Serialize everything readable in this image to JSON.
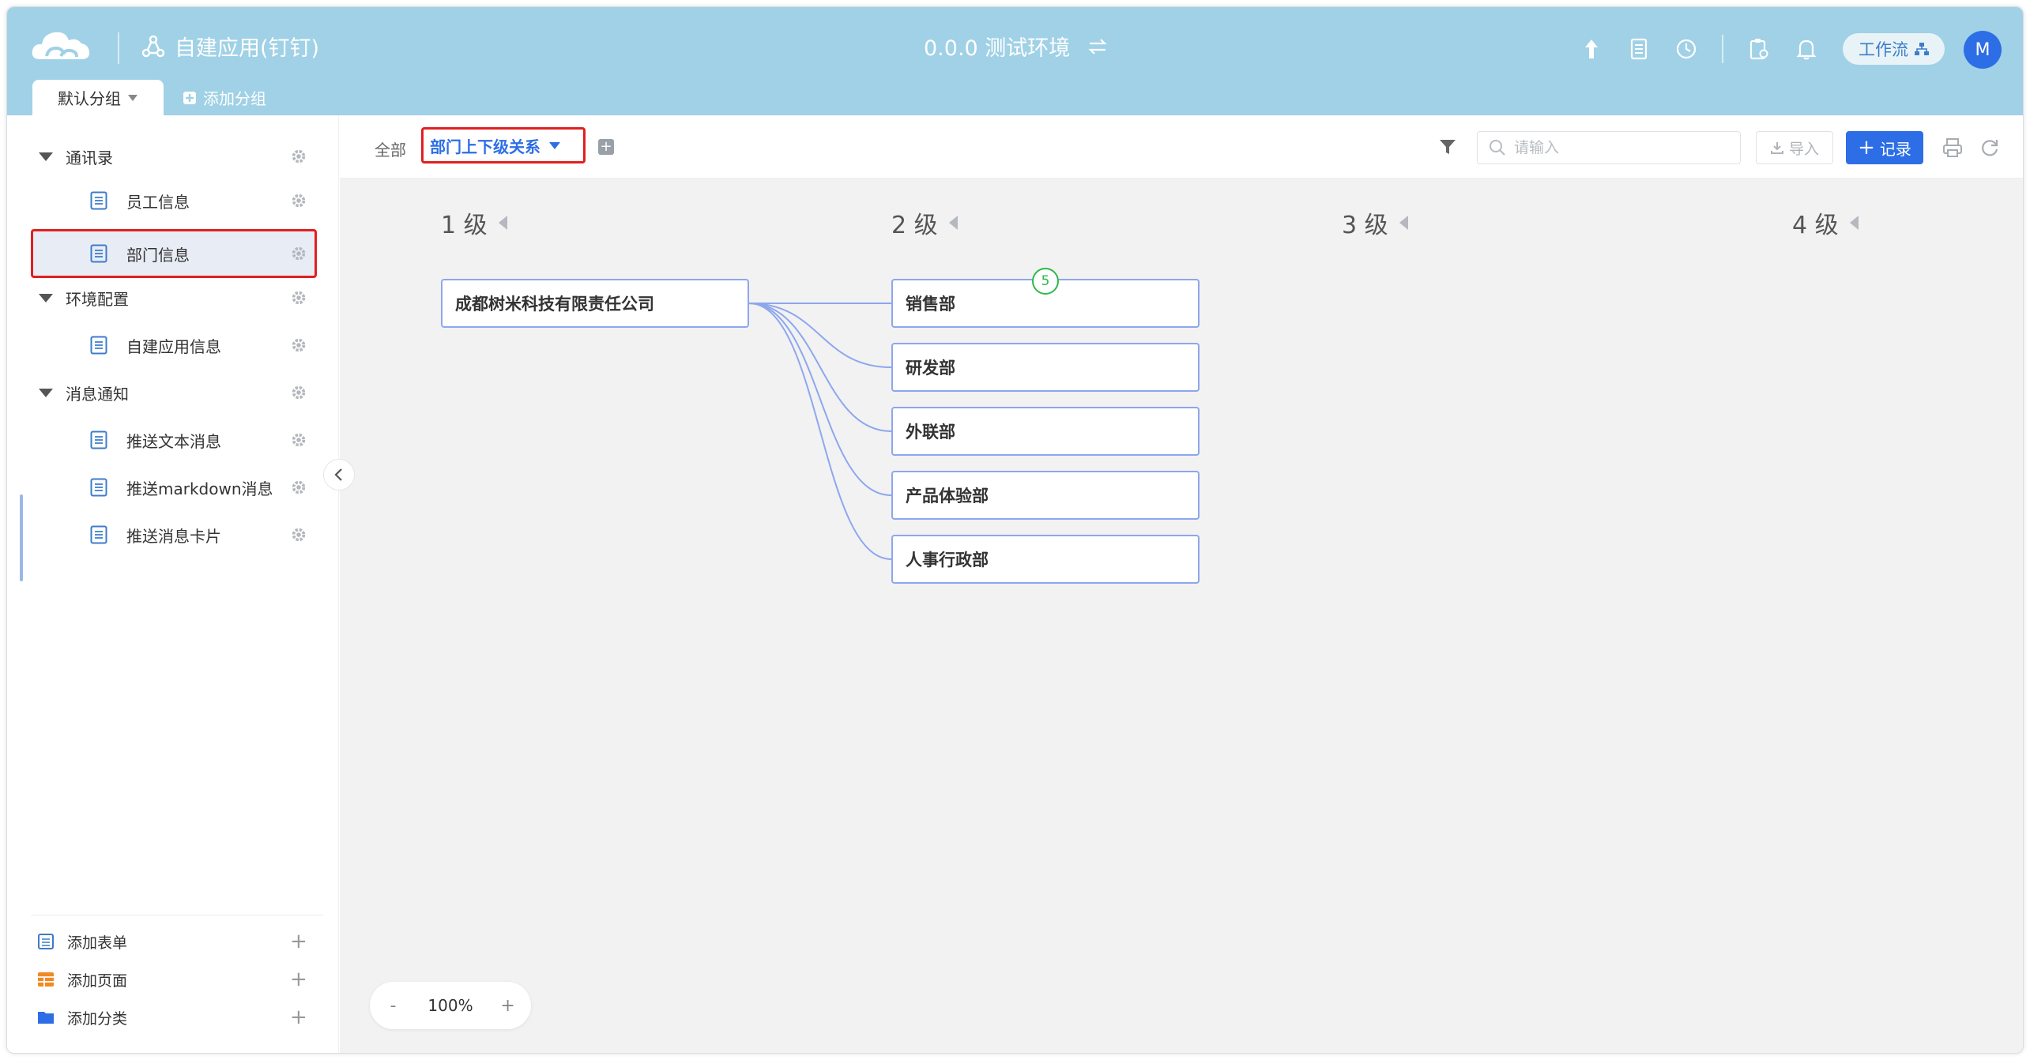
{
  "header": {
    "app_title": "自建应用(钉钉)",
    "environment": "0.0.0 测试环境",
    "workflow_label": "工作流",
    "avatar_initial": "M"
  },
  "groups": {
    "default_label": "默认分组",
    "add_label": "添加分组"
  },
  "sidebar": {
    "groups": [
      {
        "label": "通讯录",
        "items": [
          "员工信息",
          "部门信息"
        ]
      },
      {
        "label": "环境配置",
        "items": [
          "自建应用信息"
        ]
      },
      {
        "label": "消息通知",
        "items": [
          "推送文本消息",
          "推送markdown消息",
          "推送消息卡片"
        ]
      }
    ],
    "selected_item": "部门信息",
    "footer": {
      "add_form": "添加表单",
      "add_page": "添加页面",
      "add_category": "添加分类"
    }
  },
  "toolbar": {
    "all_label": "全部",
    "view_label": "部门上下级关系",
    "search_placeholder": "请输入",
    "import_label": "导入",
    "record_label": "记录"
  },
  "org_chart": {
    "levels": [
      "1 级",
      "2 级",
      "3 级",
      "4 级"
    ],
    "root": {
      "name": "成都树米科技有限责任公司",
      "child_count": "5"
    },
    "children": [
      "销售部",
      "研发部",
      "外联部",
      "产品体验部",
      "人事行政部"
    ],
    "link_color": "#8da7ee"
  },
  "zoom": {
    "minus": "-",
    "value": "100%",
    "plus": "+"
  },
  "colors": {
    "header_bg": "#a0d1e6",
    "accent": "#2d6ee6",
    "highlight_border": "#e02020",
    "count_badge": "#2fb84a"
  }
}
